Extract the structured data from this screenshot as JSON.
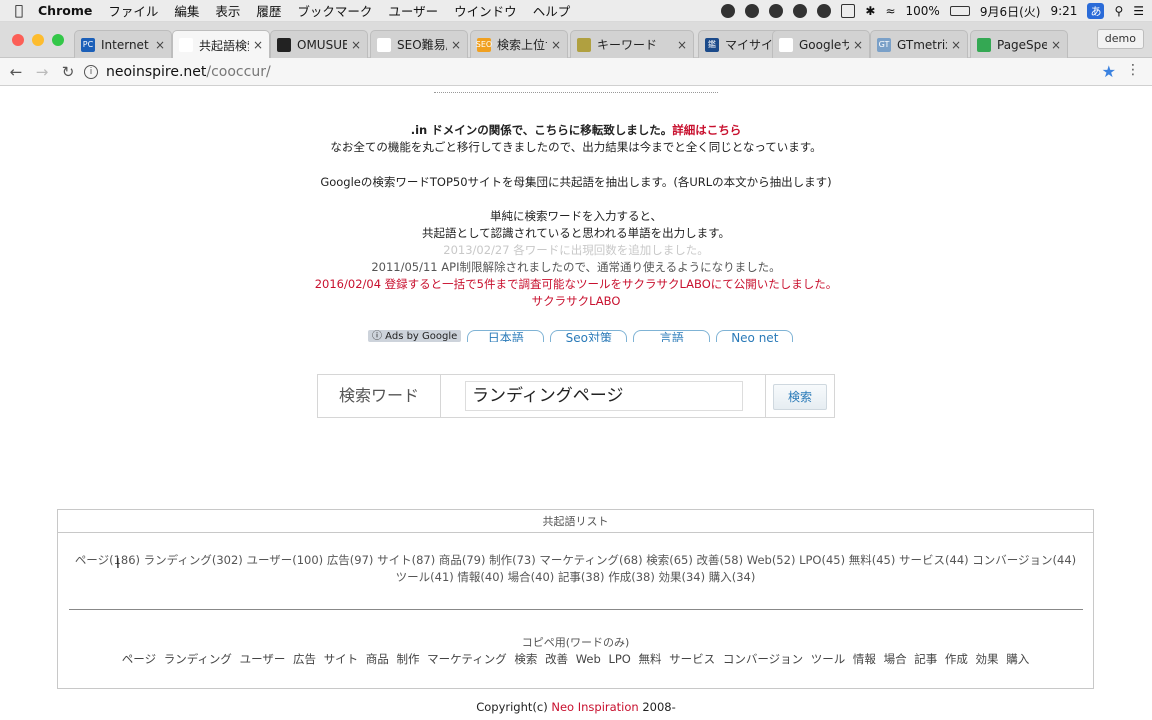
{
  "menubar": {
    "app": "Chrome",
    "items": [
      "ファイル",
      "編集",
      "表示",
      "履歴",
      "ブックマーク",
      "ユーザー",
      "ウインドウ",
      "ヘルプ"
    ],
    "battery": "100%",
    "date": "9月6日(火)",
    "time": "9:21",
    "ime": "あ"
  },
  "tabs": [
    {
      "title": "Internet A",
      "fav_color": "#1b5fb8",
      "fav_text": "PC"
    },
    {
      "title": "共起語検索",
      "fav_color": "#ffffff",
      "fav_text": ""
    },
    {
      "title": "OMUSUBI",
      "fav_color": "#222222",
      "fav_text": ""
    },
    {
      "title": "SEO難易度",
      "fav_color": "#ffffff",
      "fav_text": ""
    },
    {
      "title": "検索上位サ",
      "fav_color": "#f0a020",
      "fav_text": "SEO"
    },
    {
      "title": "キーワード",
      "fav_color": "#b0a040",
      "fav_text": ""
    },
    {
      "title": "マイサイト",
      "fav_color": "#1b4a8a",
      "fav_text": "鑑"
    },
    {
      "title": "Googleサ",
      "fav_color": "#ffffff",
      "fav_text": ""
    },
    {
      "title": "GTmetrix",
      "fav_color": "#7aa0c8",
      "fav_text": "GT"
    },
    {
      "title": "PageSpee",
      "fav_color": "#34a853",
      "fav_text": ""
    }
  ],
  "profile": "demo",
  "address": {
    "host": "neoinspire.net",
    "path": "/cooccur/"
  },
  "intro": {
    "line1_bold": ".in ドメインの関係で、こちらに移転致しました。",
    "line1_link": "詳細はこちら",
    "line2": "なお全ての機能を丸ごと移行してきましたので、出力結果は今までと全く同じとなっています。",
    "line3": "Googleの検索ワードTOP50サイトを母集団に共起語を抽出します。(各URLの本文から抽出します)",
    "line4": "単純に検索ワードを入力すると、",
    "line5": "共起語として認識されていると思われる単語を出力します。",
    "line6": "2013/02/27 各ワードに出現回数を追加しました。",
    "line7": "2011/05/11 API制限解除されましたので、通常通り使えるようになりました。",
    "line8": "2016/02/04 登録すると一括で5件まで調査可能なツールをサクラサクLABOにて公開いたしました。",
    "line9": "サクラサクLABO"
  },
  "ads": {
    "label": "ⓘ Ads by Google",
    "links": [
      "日本語",
      "Seo対策",
      "言語",
      "Neo net"
    ]
  },
  "search": {
    "label": "検索ワード",
    "value": "ランディングページ",
    "button": "検索"
  },
  "cooccur": {
    "heading": "共起語リスト",
    "items": [
      "ページ(186)",
      "ランディング(302)",
      "ユーザー(100)",
      "広告(97)",
      "サイト(87)",
      "商品(79)",
      "制作(73)",
      "マーケティング(68)",
      "検索(65)",
      "改善(58)",
      "Web(52)",
      "LPO(45)",
      "無料(45)",
      "サービス(44)",
      "コンバージョン(44)",
      "ツール(41)",
      "情報(40)",
      "場合(40)",
      "記事(38)",
      "作成(38)",
      "効果(34)",
      "購入(34)"
    ],
    "copy_heading": "コピペ用(ワードのみ)",
    "words": [
      "ページ",
      "ランディング",
      "ユーザー",
      "広告",
      "サイト",
      "商品",
      "制作",
      "マーケティング",
      "検索",
      "改善",
      "Web",
      "LPO",
      "無料",
      "サービス",
      "コンバージョン",
      "ツール",
      "情報",
      "場合",
      "記事",
      "作成",
      "効果",
      "購入"
    ]
  },
  "footer": {
    "prefix": "Copyright(c) ",
    "brand": "Neo Inspiration",
    "suffix": " 2008-"
  }
}
